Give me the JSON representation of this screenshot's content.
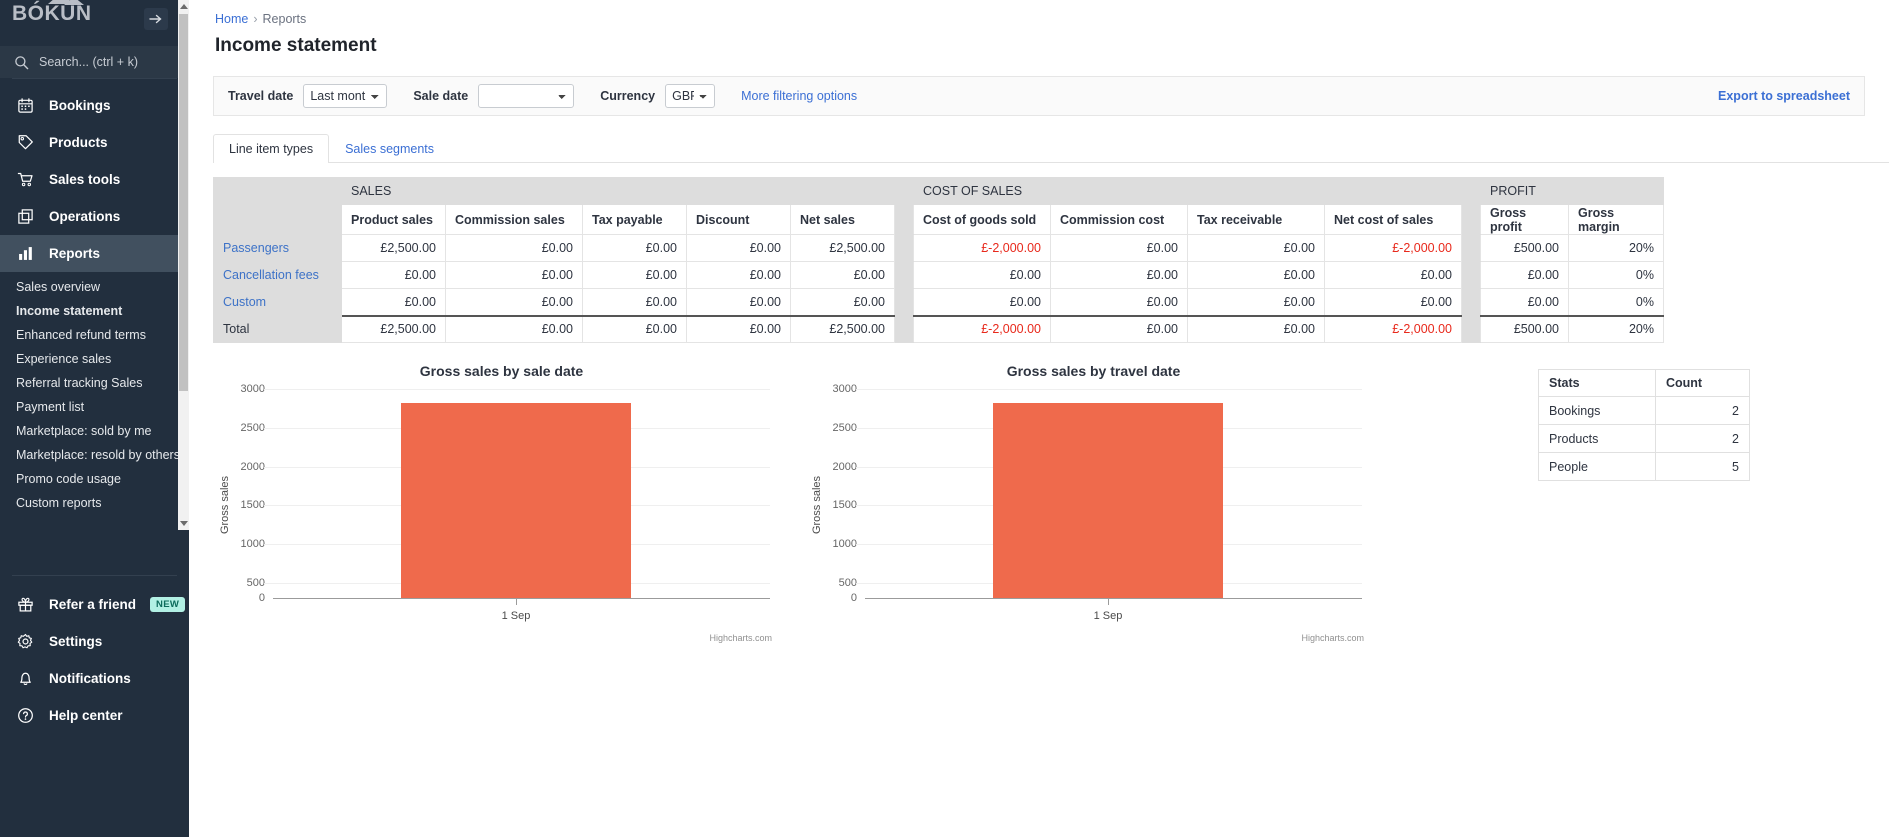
{
  "sidebar": {
    "logo": "BÓKUN",
    "collapse_icon": "arrow-right-icon",
    "search_placeholder": "Search... (ctrl + k)",
    "nav": [
      {
        "label": "Bookings",
        "icon": "calendar-icon",
        "active": false
      },
      {
        "label": "Products",
        "icon": "tag-icon",
        "active": false
      },
      {
        "label": "Sales tools",
        "icon": "cart-icon",
        "active": false
      },
      {
        "label": "Operations",
        "icon": "copy-icon",
        "active": false
      },
      {
        "label": "Reports",
        "icon": "bar-chart-icon",
        "active": true
      }
    ],
    "subnav": [
      {
        "label": "Sales overview",
        "current": false
      },
      {
        "label": "Income statement",
        "current": true
      },
      {
        "label": "Enhanced refund terms",
        "current": false
      },
      {
        "label": "Experience sales",
        "current": false
      },
      {
        "label": "Referral tracking Sales",
        "current": false
      },
      {
        "label": "Payment list",
        "current": false
      },
      {
        "label": "Marketplace: sold by me",
        "current": false
      },
      {
        "label": "Marketplace: resold by others",
        "current": false
      },
      {
        "label": "Promo code usage",
        "current": false
      },
      {
        "label": "Custom reports",
        "current": false
      }
    ],
    "bottom": [
      {
        "label": "Refer a friend",
        "icon": "gift-icon",
        "badge": "NEW"
      },
      {
        "label": "Settings",
        "icon": "gear-icon",
        "badge": ""
      },
      {
        "label": "Notifications",
        "icon": "bell-icon",
        "badge": ""
      },
      {
        "label": "Help center",
        "icon": "question-circle-icon",
        "badge": ""
      }
    ]
  },
  "breadcrumb": {
    "home": "Home",
    "sep": "›",
    "current": "Reports"
  },
  "page_title": "Income statement",
  "filters": {
    "travel_date_label": "Travel date",
    "travel_date_value": "Last month",
    "sale_date_label": "Sale date",
    "sale_date_value": "",
    "currency_label": "Currency",
    "currency_value": "GBP",
    "more_options": "More filtering options",
    "export": "Export to spreadsheet"
  },
  "tabs": [
    {
      "label": "Line item types",
      "active": true
    },
    {
      "label": "Sales segments",
      "active": false
    }
  ],
  "table": {
    "groups": {
      "sales": "SALES",
      "cost": "COST OF SALES",
      "profit": "PROFIT"
    },
    "columns": {
      "sales": [
        "Product sales",
        "Commission sales",
        "Tax payable",
        "Discount",
        "Net sales"
      ],
      "cost": [
        "Cost of goods sold",
        "Commission cost",
        "Tax receivable",
        "Net cost of sales"
      ],
      "profit": [
        "Gross profit",
        "Gross margin"
      ]
    },
    "rows": [
      {
        "label": "Passengers",
        "sales": [
          "£2,500.00",
          "£0.00",
          "£0.00",
          "£0.00",
          "£2,500.00"
        ],
        "cost": [
          "£-2,000.00",
          "£0.00",
          "£0.00",
          "£-2,000.00"
        ],
        "cost_neg": [
          true,
          false,
          false,
          true
        ],
        "profit": [
          "£500.00",
          "20%"
        ]
      },
      {
        "label": "Cancellation fees",
        "sales": [
          "£0.00",
          "£0.00",
          "£0.00",
          "£0.00",
          "£0.00"
        ],
        "cost": [
          "£0.00",
          "£0.00",
          "£0.00",
          "£0.00"
        ],
        "cost_neg": [
          false,
          false,
          false,
          false
        ],
        "profit": [
          "£0.00",
          "0%"
        ]
      },
      {
        "label": "Custom",
        "sales": [
          "£0.00",
          "£0.00",
          "£0.00",
          "£0.00",
          "£0.00"
        ],
        "cost": [
          "£0.00",
          "£0.00",
          "£0.00",
          "£0.00"
        ],
        "cost_neg": [
          false,
          false,
          false,
          false
        ],
        "profit": [
          "£0.00",
          "0%"
        ]
      }
    ],
    "total": {
      "label": "Total",
      "sales": [
        "£2,500.00",
        "£0.00",
        "£0.00",
        "£0.00",
        "£2,500.00"
      ],
      "cost": [
        "£-2,000.00",
        "£0.00",
        "£0.00",
        "£-2,000.00"
      ],
      "cost_neg": [
        true,
        false,
        false,
        true
      ],
      "profit": [
        "£500.00",
        "20%"
      ]
    }
  },
  "stats": {
    "headers": [
      "Stats",
      "Count"
    ],
    "rows": [
      {
        "name": "Bookings",
        "count": "2"
      },
      {
        "name": "Products",
        "count": "2"
      },
      {
        "name": "People",
        "count": "5"
      }
    ]
  },
  "chart_data": [
    {
      "type": "bar",
      "title": "Gross sales by sale date",
      "xlabel": "",
      "ylabel": "Gross sales",
      "categories": [
        "1 Sep"
      ],
      "values": [
        2500
      ],
      "ylim": [
        0,
        3000
      ],
      "yticks": [
        0,
        500,
        1000,
        1500,
        2000,
        2500,
        3000
      ],
      "bar_color": "#ef6a4c",
      "grid": true,
      "legend": "none",
      "credit": "Highcharts.com"
    },
    {
      "type": "bar",
      "title": "Gross sales by travel date",
      "xlabel": "",
      "ylabel": "Gross sales",
      "categories": [
        "1 Sep"
      ],
      "values": [
        2500
      ],
      "ylim": [
        0,
        3000
      ],
      "yticks": [
        0,
        500,
        1000,
        1500,
        2000,
        2500,
        3000
      ],
      "bar_color": "#ef6a4c",
      "grid": true,
      "legend": "none",
      "credit": "Highcharts.com"
    }
  ]
}
